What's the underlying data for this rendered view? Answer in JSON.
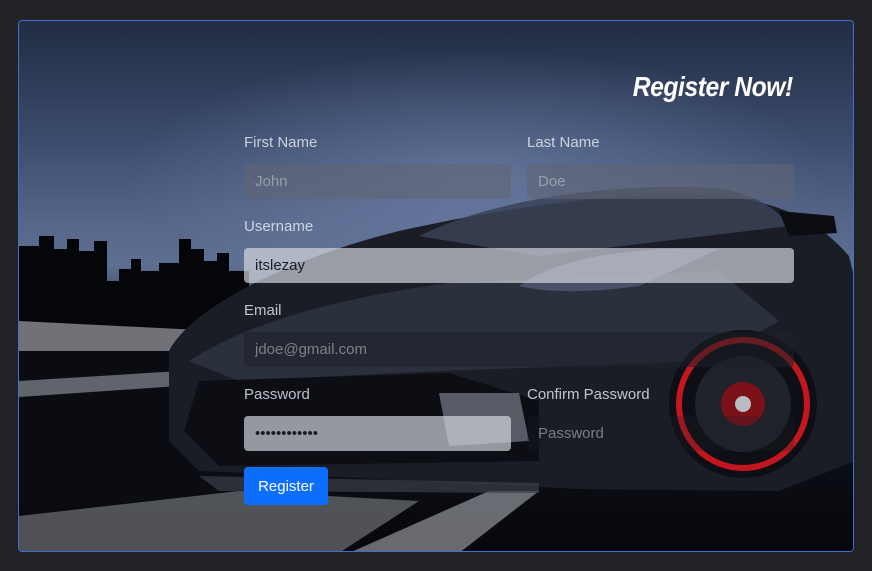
{
  "form": {
    "title": "Register Now!",
    "first_name": {
      "label": "First Name",
      "placeholder": "John",
      "value": ""
    },
    "last_name": {
      "label": "Last Name",
      "placeholder": "Doe",
      "value": ""
    },
    "username": {
      "label": "Username",
      "placeholder": "",
      "value": "itslezay"
    },
    "email": {
      "label": "Email",
      "placeholder": "jdoe@gmail.com",
      "value": ""
    },
    "password": {
      "label": "Password",
      "placeholder": "",
      "value": "••••••••••••"
    },
    "confirm_password": {
      "label": "Confirm Password",
      "placeholder": "Password",
      "value": ""
    },
    "submit_label": "Register"
  },
  "colors": {
    "accent": "#0d6efd",
    "card_border": "#3d6fd4",
    "page_background": "#202225"
  }
}
